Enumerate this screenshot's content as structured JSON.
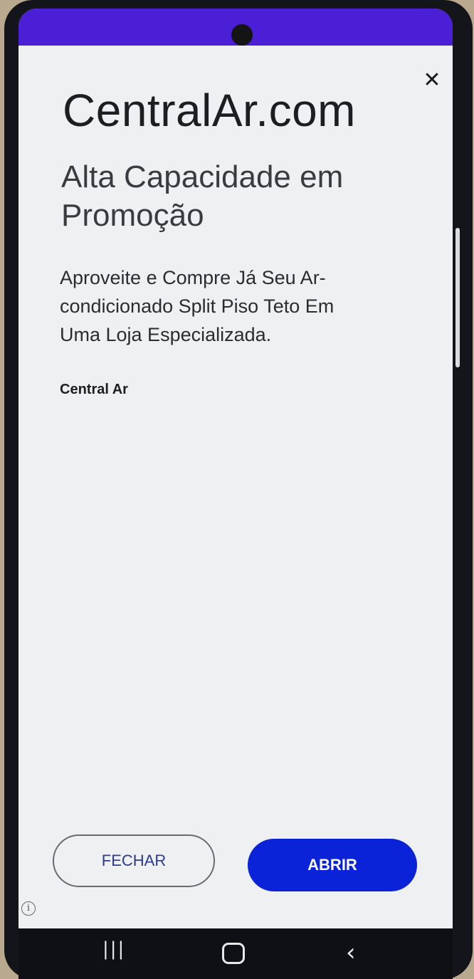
{
  "status_bar": {
    "color": "#4a1fd6"
  },
  "ad": {
    "close_icon": "close-icon",
    "close_glyph": "✕",
    "headline": "CentralAr.com",
    "subheadline": "Alta Capacidade em Promoção",
    "description": "Aproveite e Compre Já Seu Ar-condicionado Split Piso Teto Em Uma Loja Especializada.",
    "advertiser": "Central Ar",
    "info_glyph": "i"
  },
  "buttons": {
    "close_label": "FECHAR",
    "open_label": "ABRIR",
    "accent": "#0a23d8"
  },
  "navigation": {
    "recents_glyph": "|||",
    "back_glyph": "‹"
  }
}
